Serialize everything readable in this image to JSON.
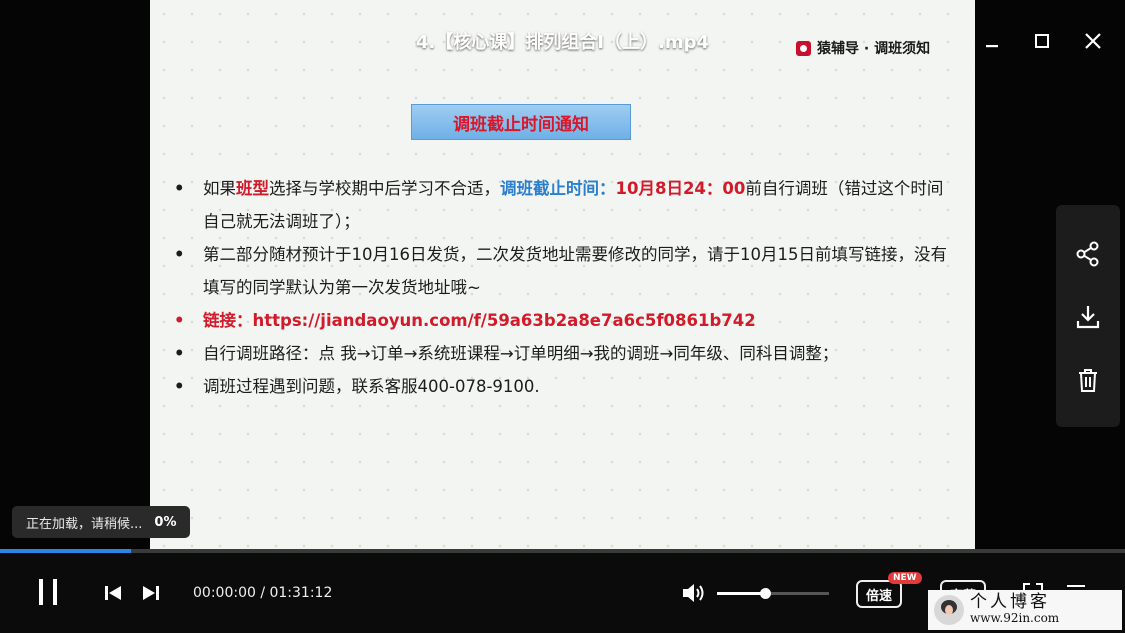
{
  "window": {
    "title": "4.【核心课】排列组合I（上）.mp4"
  },
  "slide": {
    "brand": "猿辅导 · 调班须知",
    "notice_title": "调班截止时间通知",
    "bullets": {
      "b1_prefix": "如果",
      "b1_highlight1": "班型",
      "b1_mid": "选择与学校期中后学习不合适，",
      "b1_deadline_label": "调班截止时间：",
      "b1_deadline_value": "10月8日24：00",
      "b1_suffix": "前自行调班（错过这个时间自己就无法调班了）；",
      "b2": "第二部分随材预计于10月16日发货，二次发货地址需要修改的同学，请于10月15日前填写链接，没有填写的同学默认为第一次发货地址哦~",
      "b3": "链接：https://jiandaoyun.com/f/59a63b2a8e7a6c5f0861b742",
      "b4": "自行调班路径：点 我→订单→系统班课程→订单明细→我的调班→同年级、同科目调整；",
      "b5": "调班过程遇到问题，联系客服400-078-9100."
    }
  },
  "loading": {
    "text": "正在加载，请稍候...",
    "percent": "0%"
  },
  "player": {
    "time": "00:00:00 / 01:31:12",
    "played_fraction": 0.116,
    "volume_fraction": 0.43,
    "speed_label": "倍速",
    "new_badge": "NEW",
    "subtitle_label": "字幕"
  },
  "watermark": {
    "title": "个人博客",
    "url": "www.92in.com"
  },
  "icons": {
    "minimize": "minimize-icon",
    "maximize": "maximize-icon",
    "close": "close-icon",
    "share": "share-icon",
    "download": "download-icon",
    "delete": "trash-icon",
    "pause": "pause-icon",
    "prev": "skip-previous-icon",
    "next": "skip-next-icon",
    "volume": "volume-icon",
    "fullscreen": "fullscreen-icon",
    "menu": "menu-icon"
  },
  "colors": {
    "accent": "#2f83e4",
    "highlight_red": "#d11a2a",
    "highlight_blue": "#2a7fcf"
  }
}
